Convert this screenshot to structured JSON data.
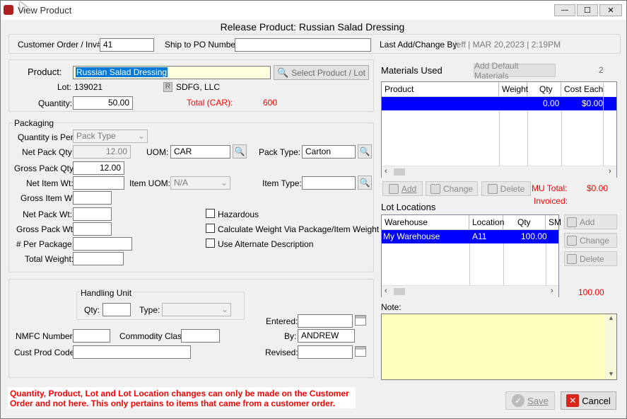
{
  "window": {
    "title": "View Product",
    "controls": {
      "minimize": "—",
      "maximize": "☐",
      "close": "✕"
    }
  },
  "header": {
    "title": "Release Product: Russian Salad Dressing"
  },
  "top": {
    "customer_order_label": "Customer Order / Inv#:",
    "customer_order_value": "41",
    "ship_po_label": "Ship to PO Number:",
    "ship_po_value": "",
    "last_change_label": "Last Add/Change By:",
    "last_change_value": "jeff | MAR 20,2023 |  2:19PM"
  },
  "product": {
    "product_label": "Product:",
    "product_value": "Russian Salad Dressing",
    "select_button": "Select Product / Lot",
    "lot_label": "Lot:",
    "lot_value": "139021",
    "company_badge": "R",
    "company_name": "SDFG, LLC",
    "quantity_label": "Quantity:",
    "quantity_value": "50.00",
    "total_label": "Total (CAR):",
    "total_value": "600"
  },
  "packaging": {
    "group_label": "Packaging",
    "qty_per_label": "Quantity is Per:",
    "qty_per_value": "Pack Type",
    "net_pack_qty_label": "Net Pack Qty:",
    "net_pack_qty_value": "12.00",
    "uom_label": "UOM:",
    "uom_value": "CAR",
    "pack_type_label": "Pack Type:",
    "pack_type_value": "Carton",
    "gross_pack_qty_label": "Gross Pack Qty:",
    "gross_pack_qty_value": "12.00",
    "net_item_wt_label": "Net Item Wt:",
    "net_item_wt_value": "",
    "item_uom_label": "Item UOM:",
    "item_uom_value": "N/A",
    "item_type_label": "Item Type:",
    "item_type_value": "",
    "gross_item_wt_label": "Gross Item Wt:",
    "net_pack_wt_label": "Net Pack Wt:",
    "gross_pack_wt_label": "Gross Pack Wt:",
    "per_package_label": "# Per Package:",
    "total_weight_label": "Total Weight:",
    "hazardous_label": "Hazardous",
    "calc_weight_label": "Calculate Weight Via Package/Item Weight",
    "alt_desc_label": "Use Alternate Description"
  },
  "handling": {
    "group_label": "Handling Unit",
    "qty_label": "Qty:",
    "type_label": "Type:",
    "entered_label": "Entered:",
    "by_label": "By:",
    "by_value": "ANDREW",
    "revised_label": "Revised:",
    "nmfc_label": "NMFC Number:",
    "commodity_label": "Commodity Class:",
    "cust_prod_label": "Cust Prod Code:"
  },
  "warning": {
    "line1": "Quantity, Product, Lot and Lot Location changes can only be made on the Customer",
    "line2": "Order and not here.  This only pertains to items that came from a customer order."
  },
  "materials": {
    "title": "Materials Used",
    "add_default_button": "Add Default Materials",
    "count": "2",
    "columns": [
      "Product",
      "Weight",
      "Qty",
      "Cost Each"
    ],
    "rows": [
      {
        "product": "",
        "weight": "",
        "qty": "0.00",
        "cost": "$0.00"
      }
    ],
    "add_button": "Add",
    "change_button": "Change",
    "delete_button": "Delete",
    "mu_total_label": "MU Total:",
    "mu_total_value": "$0.00",
    "invoiced_label": "Invoiced:"
  },
  "lot_locations": {
    "title": "Lot Locations",
    "columns": [
      "Warehouse",
      "Location",
      "Qty",
      "SM"
    ],
    "rows": [
      {
        "warehouse": "My Warehouse",
        "location": "A11",
        "qty": "100.00"
      }
    ],
    "add_button": "Add",
    "change_button": "Change",
    "delete_button": "Delete",
    "total": "100.00"
  },
  "note": {
    "label": "Note:",
    "value": ""
  },
  "actions": {
    "save": "Save",
    "cancel": "Cancel"
  },
  "colors": {
    "selection": "#0000ff",
    "note_bg": "#ffffc0",
    "warning": "#ff0000"
  }
}
